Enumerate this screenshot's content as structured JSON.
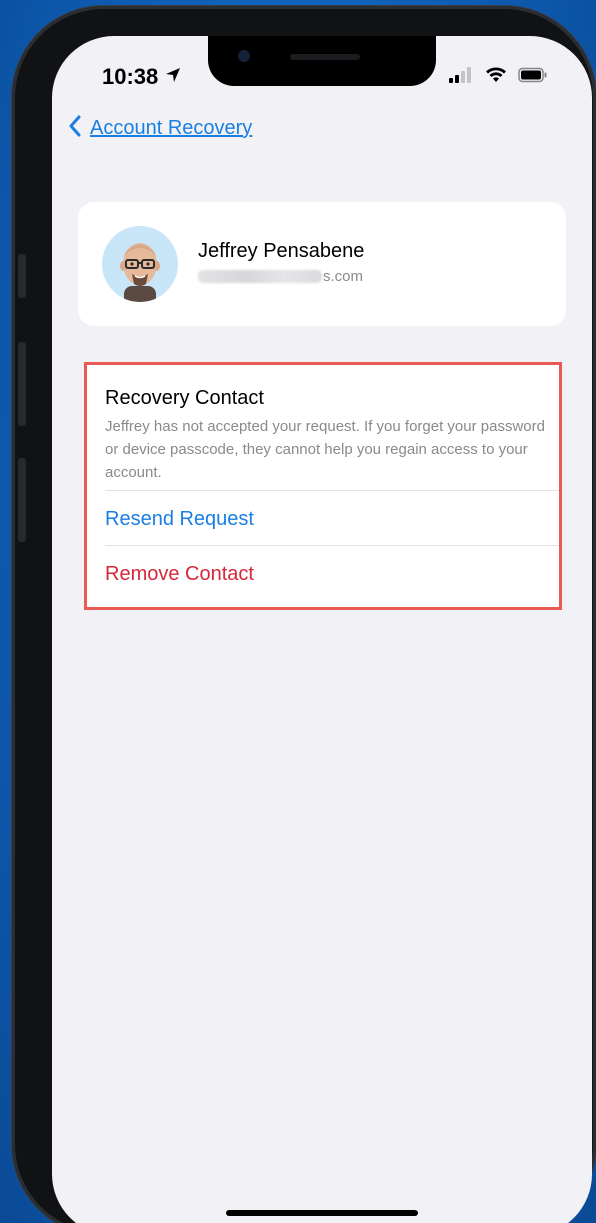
{
  "status_bar": {
    "time": "10:38",
    "icons": [
      "location-arrow-icon",
      "signal-icon",
      "wifi-icon",
      "battery-icon"
    ]
  },
  "nav": {
    "back_label": "Account Recovery",
    "back_icon": "chevron-left-icon"
  },
  "profile": {
    "name": "Jeffrey Pensabene",
    "email_suffix": "s.com",
    "avatar_icon": "memoji-avatar-icon"
  },
  "recovery_contact": {
    "title": "Recovery Contact",
    "description": "Jeffrey has not accepted your request. If you forget your password or device passcode, they cannot help you regain access to your account.",
    "resend_label": "Resend Request",
    "remove_label": "Remove Contact"
  },
  "colors": {
    "accent_blue": "#1a7fe3",
    "destructive_red": "#d6283a",
    "highlight_border": "#ea5a55",
    "background": "#f2f1f6"
  }
}
